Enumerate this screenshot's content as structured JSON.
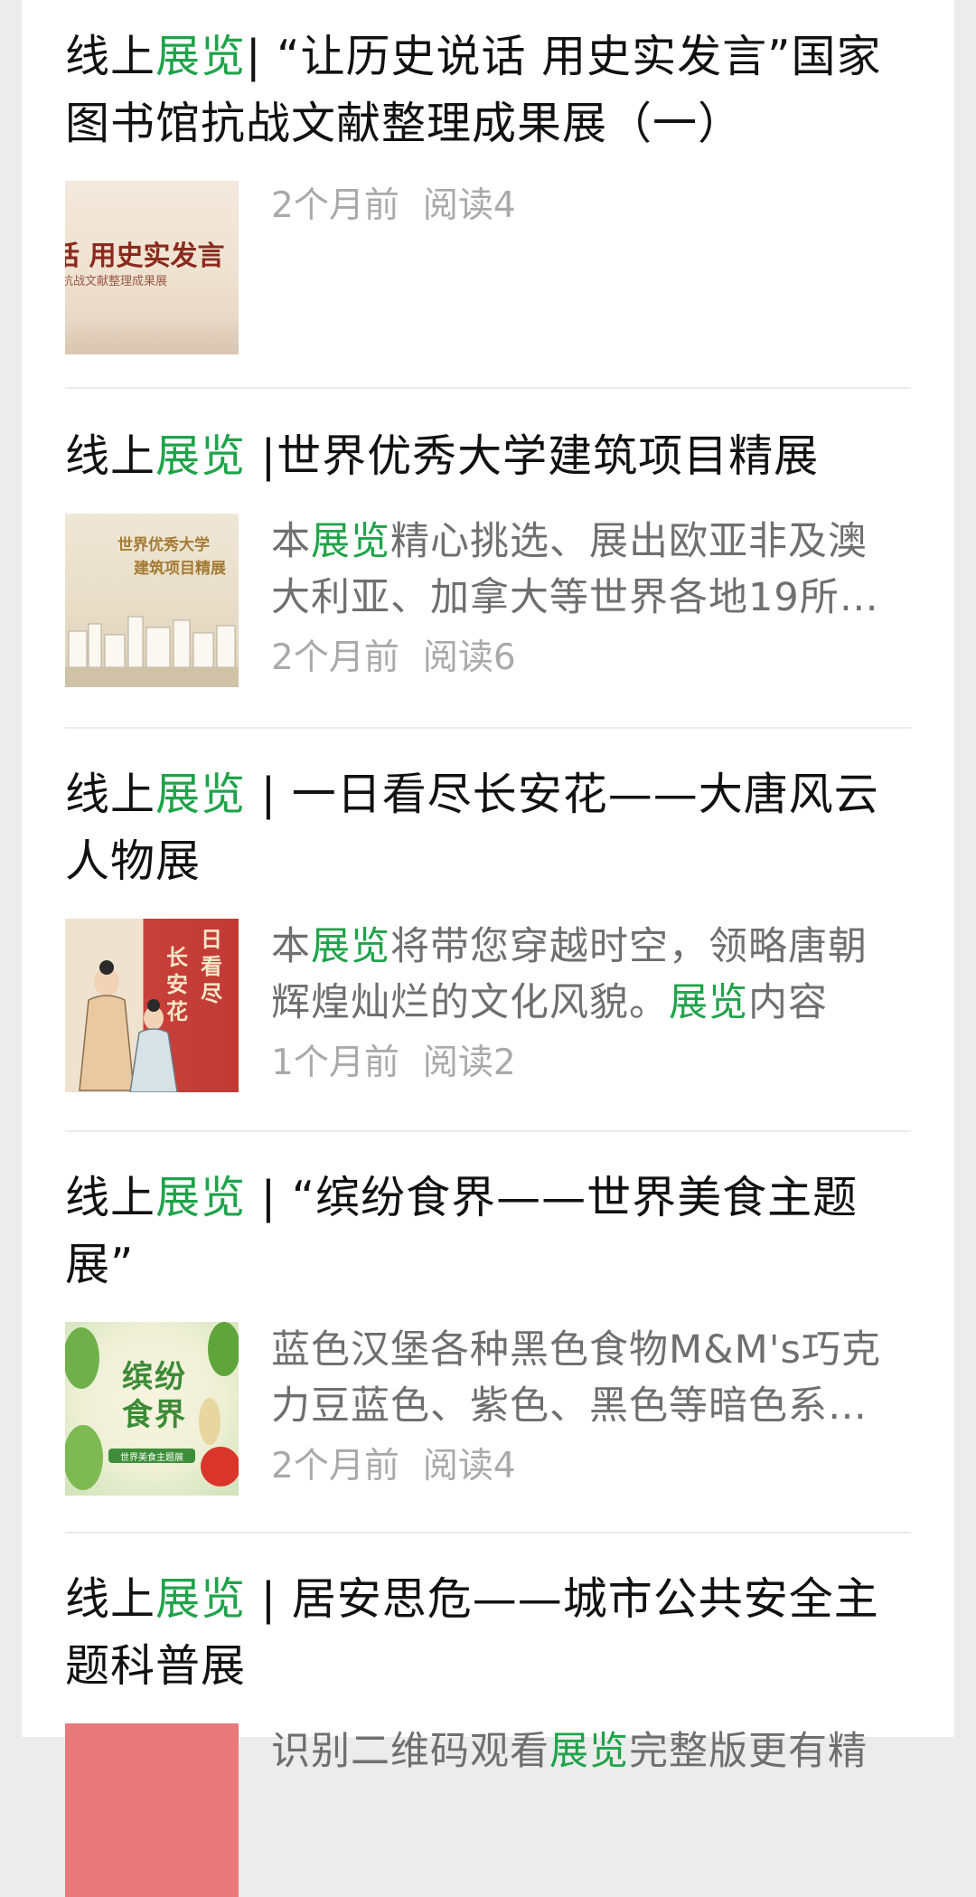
{
  "accent_color": "#1fa34a",
  "articles": [
    {
      "title_pre": "线上",
      "title_hl": "展览",
      "title_post": "| “让历史说话 用史实发言”国家图书馆抗战文献整理成果展（一）",
      "thumb_text": "话 用史实发言",
      "thumb_sub": "抗战文献整理成果展",
      "desc": [],
      "time": "2个月前",
      "reads": "阅读4"
    },
    {
      "title_pre": "线上",
      "title_hl": "展览",
      "title_post": " |世界优秀大学建筑项目精展",
      "thumb_text": "世界优秀大学",
      "thumb_sub": "建筑项目精展",
      "desc": [
        {
          "t": "本",
          "hl": false
        },
        {
          "t": "展览",
          "hl": true
        },
        {
          "t": "精心挑选、展出欧亚非及澳大利亚、加拿大等世界各地19所…",
          "hl": false
        }
      ],
      "time": "2个月前",
      "reads": "阅读6"
    },
    {
      "title_pre": "线上",
      "title_hl": "展览",
      "title_post": " | 一日看尽长安花——大唐风云人物展",
      "thumb_text": "长安花",
      "thumb_sub": "日看尽",
      "desc": [
        {
          "t": "本",
          "hl": false
        },
        {
          "t": "展览",
          "hl": true
        },
        {
          "t": "将带您穿越时空，领略唐朝辉煌灿烂的文化风貌。",
          "hl": false
        },
        {
          "t": "展览",
          "hl": true
        },
        {
          "t": "内容",
          "hl": false
        }
      ],
      "time": "1个月前",
      "reads": "阅读2"
    },
    {
      "title_pre": "线上",
      "title_hl": "展览",
      "title_post": " | “缤纷食界——世界美食主题展”",
      "thumb_text": "缤纷食界",
      "thumb_sub": "世界美食主题展",
      "desc": [
        {
          "t": "蓝色汉堡各种黑色食物M&M's巧克力豆蓝色、紫色、黑色等暗色系…",
          "hl": false
        }
      ],
      "time": "2个月前",
      "reads": "阅读4"
    },
    {
      "title_pre": "线上",
      "title_hl": "展览",
      "title_post": " | 居安思危——城市公共安全主题科普展",
      "desc": [
        {
          "t": "识别二维码观看",
          "hl": false
        },
        {
          "t": "展览",
          "hl": true
        },
        {
          "t": "完整版更有精",
          "hl": false
        }
      ]
    }
  ]
}
